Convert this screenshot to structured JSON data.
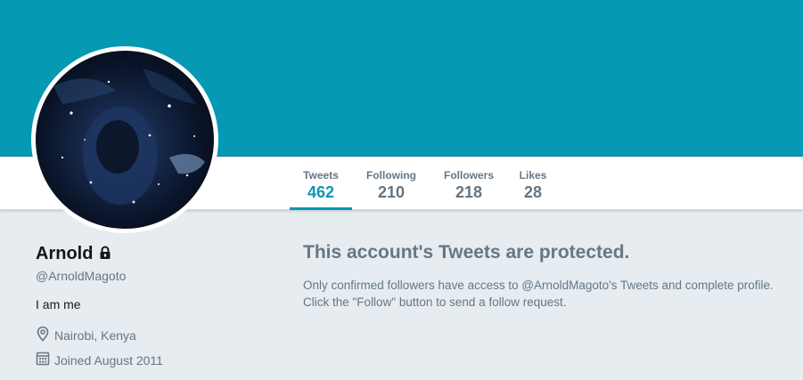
{
  "profile": {
    "name": "Arnold",
    "handle": "@ArnoldMagoto",
    "bio": "I am me",
    "location": "Nairobi, Kenya",
    "joined": "Joined August 2011",
    "banner_color": "#0599b4"
  },
  "stats": [
    {
      "label": "Tweets",
      "value": "462"
    },
    {
      "label": "Following",
      "value": "210"
    },
    {
      "label": "Followers",
      "value": "218"
    },
    {
      "label": "Likes",
      "value": "28"
    }
  ],
  "protected": {
    "title": "This account's Tweets are protected.",
    "line1": "Only confirmed followers have access to @ArnoldMagoto's Tweets and complete profile.",
    "line2": "Click the \"Follow\" button to send a follow request."
  },
  "icons": {
    "lock": "lock-icon",
    "location": "location-pin-icon",
    "calendar": "calendar-icon"
  },
  "colors": {
    "accent": "#0a96b2",
    "muted": "#657786",
    "page_bg": "#e6ecf0"
  }
}
